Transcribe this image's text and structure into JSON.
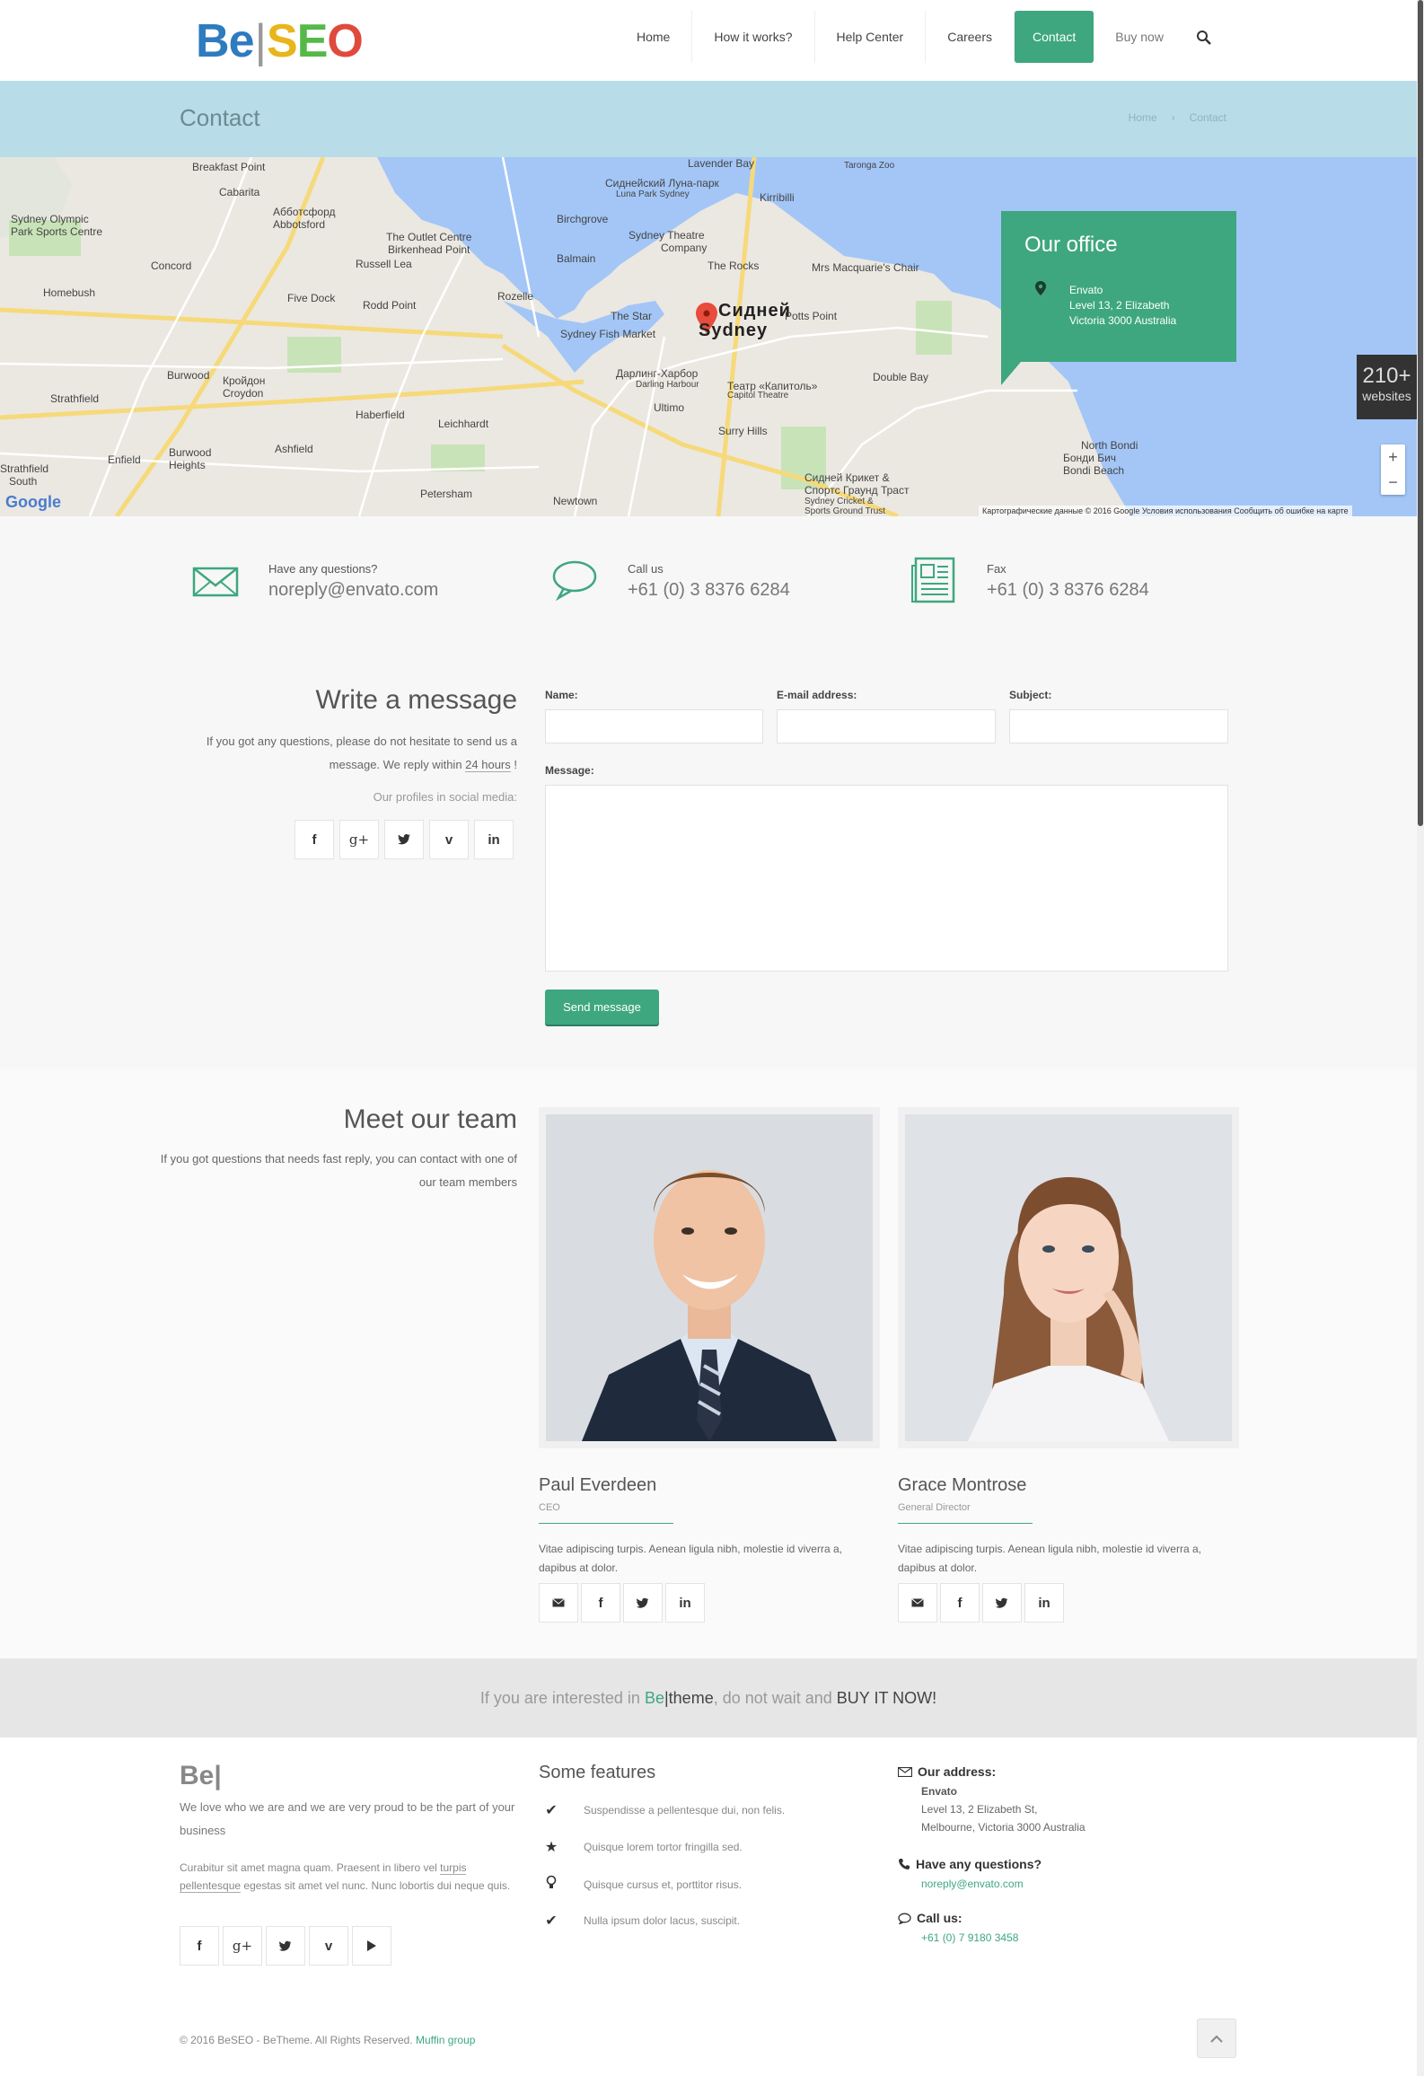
{
  "header": {
    "logo": {
      "b": "B",
      "e": "e",
      "bar": "|",
      "s": "S",
      "e2": "E",
      "o": "O"
    },
    "nav": [
      {
        "label": "Home"
      },
      {
        "label": "How it works?"
      },
      {
        "label": "Help Center"
      },
      {
        "label": "Careers"
      },
      {
        "label": "Contact",
        "active": true
      },
      {
        "label": "Buy now"
      }
    ]
  },
  "subheader": {
    "title": "Contact",
    "breadcrumb": [
      "Home",
      "›",
      "Contact"
    ]
  },
  "map": {
    "labels": {
      "l1": "Breakfast Point",
      "l2": "Cabarita",
      "l3": "Абботсфорд",
      "l4": "Abbotsford",
      "l5": "Sydney Olympic",
      "l6": "Park Sports Centre",
      "l7": "Concord",
      "l8": "The Outlet Centre",
      "l9": "Birkenhead Point",
      "l10": "Russell Lea",
      "l11": "Homebush",
      "l12": "Five Dock",
      "l13": "Rodd Point",
      "l14": "Rozelle",
      "l15": "Birchgrove",
      "l16": "Balmain",
      "l17": "Сиднейский Луна-парк",
      "l18": "Luna Park Sydney",
      "l19": "Lavender Bay",
      "l20": "Kirribilli",
      "l21": "Sydney Theatre",
      "l22": "Company",
      "l23": "The Rocks",
      "l24": "Mrs Macquarie's Chair",
      "l25": "The Star",
      "l26": "Sydney Fish Market",
      "l27": "Сидней",
      "l28": "Sydney",
      "l29": "Potts Point",
      "l30": "Дарлинг-Харбор",
      "l31": "Darling Harbour",
      "l32": "Театр «Капитоль»",
      "l33": "Capitol Theatre",
      "l34": "Ultimo",
      "l35": "Strathfield",
      "l36": "Burwood",
      "l37": "Кройдон",
      "l38": "Croydon",
      "l39": "Haberfield",
      "l40": "Leichhardt",
      "l41": "Surry Hills",
      "l42": "Double Bay",
      "l43": "Enfield",
      "l44": "Burwood",
      "l45": "Heights",
      "l46": "Ashfield",
      "l47": "Petersham",
      "l48": "Newtown",
      "l49": "Strathfield",
      "l50": "South",
      "l51": "Сидней Крикет &",
      "l52": "Спортс Граунд Траст",
      "l53": "Sydney Cricket &",
      "l54": "Sports Ground Trust",
      "l55": "North Bondi",
      "l56": "Бонди Бич",
      "l57": "Bondi Beach",
      "l58": "Taronga Zoo"
    },
    "google": "Google",
    "copyright": "Картографические данные © 2016 Google   Условия использования   Сообщить об ошибке на карте",
    "zoom_in": "+",
    "zoom_out": "−"
  },
  "office": {
    "title": "Our office",
    "lines": [
      "Envato",
      "Level 13, 2 Elizabeth",
      "Victoria 3000 Australia"
    ]
  },
  "websites": {
    "count": "210+",
    "label": "websites"
  },
  "contact_info": [
    {
      "label": "Have any questions?",
      "value": "noreply@envato.com"
    },
    {
      "label": "Call us",
      "value": "+61 (0) 3 8376 6284"
    },
    {
      "label": "Fax",
      "value": "+61 (0) 3 8376 6284"
    }
  ],
  "message_section": {
    "title": "Write a message",
    "text_1": "If you got any questions, please do not hesitate to send us a message. We reply within ",
    "text_hours": "24 hours",
    "text_2": " !",
    "social_label": "Our profiles in social media:",
    "socials": [
      "f",
      "g+",
      "t",
      "v",
      "in"
    ],
    "form": {
      "name_label": "Name:",
      "email_label": "E-mail address:",
      "subject_label": "Subject:",
      "message_label": "Message:",
      "send_label": "Send message"
    }
  },
  "team": {
    "title": "Meet our team",
    "text": "If you got questions that needs fast reply, you can contact with one of our team members",
    "members": [
      {
        "name": "Paul Everdeen",
        "role": "CEO",
        "desc": "Vitae adipiscing turpis. Aenean ligula nibh, molestie id viverra a, dapibus at dolor."
      },
      {
        "name": "Grace Montrose",
        "role": "General Director",
        "desc": "Vitae adipiscing turpis. Aenean ligula nibh, molestie id viverra a, dapibus at dolor."
      }
    ]
  },
  "cta": {
    "pre": "If you are interested in ",
    "be": "Be",
    "bar": "|",
    "theme": "theme",
    "mid": ", do not wait and ",
    "buy": "BUY IT NOW!"
  },
  "footer": {
    "logo": "Be|",
    "text_1": "We love who we are and we are very proud to be the part of your business",
    "text_2a": "Curabitur sit amet magna quam. Praesent in libero vel ",
    "text_2b": "turpis pellentesque",
    "text_2c": " egestas sit amet vel nunc. Nunc lobortis dui neque quis.",
    "features_title": "Some features",
    "features": [
      {
        "icon": "✔",
        "text": "Suspendisse a pellentesque dui, non felis."
      },
      {
        "icon": "★",
        "text": "Quisque lorem tortor fringilla sed."
      },
      {
        "icon": "💡",
        "text": "Quisque cursus et, porttitor risus."
      },
      {
        "icon": "✔",
        "text": "Nulla ipsum dolor lacus, suscipit."
      }
    ],
    "address_title": "Our address:",
    "address_lines": [
      "Envato",
      "Level 13, 2 Elizabeth St,",
      "Melbourne, Victoria 3000 Australia"
    ],
    "questions_title": "Have any questions?",
    "questions_email": "noreply@envato.com",
    "call_title": "Call us:",
    "call_number": "+61 (0) 7 9180 3458",
    "copyright_text": "© 2016 BeSEO - BeTheme. All Rights Reserved. ",
    "copyright_link": "Muffin group"
  },
  "colors": {
    "accent": "#3ea77f",
    "subheader_bg": "#b8dce8"
  }
}
